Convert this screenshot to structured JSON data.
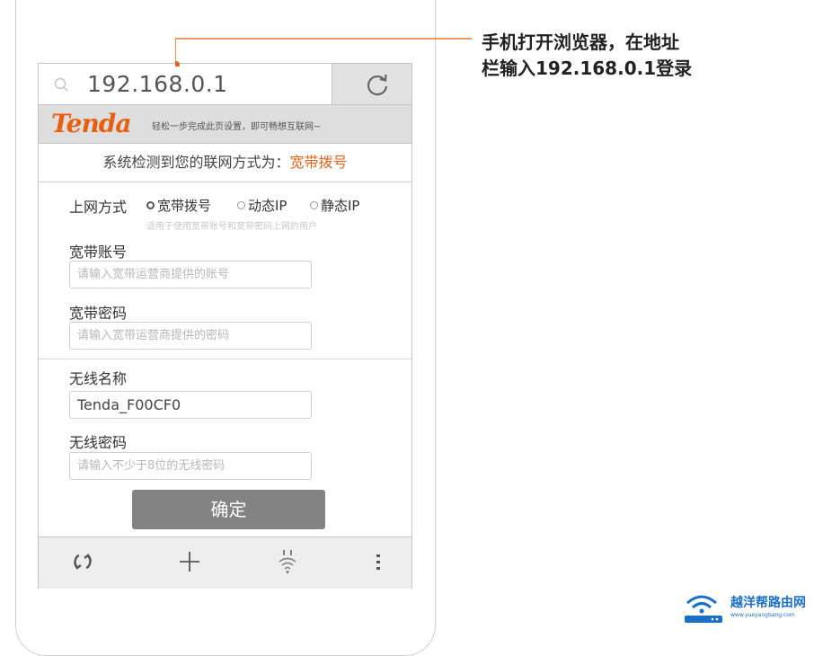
{
  "browser": {
    "url": "192.168.0.1"
  },
  "brand": {
    "logo": "Tenda",
    "slogan": "轻松一步完成此页设置，即可畅想互联网~"
  },
  "detect": {
    "prefix": "系统检测到您的联网方式为：",
    "mode": "宽带拨号"
  },
  "form": {
    "conn_label": "上网方式",
    "conn_options": [
      "宽带拨号",
      "动态IP",
      "静态IP"
    ],
    "conn_selected": "宽带拨号",
    "conn_hint": "适用于使用宽带账号和宽带密码上网的用户",
    "account_label": "宽带账号",
    "account_placeholder": "请输入宽带运营商提供的账号",
    "password_label": "宽带密码",
    "password_placeholder": "请输入宽带运营商提供的密码",
    "ssid_label": "无线名称",
    "ssid_value": "Tenda_F00CF0",
    "wifi_pwd_label": "无线密码",
    "wifi_pwd_placeholder": "请输入不少于8位的无线密码",
    "submit_label": "确定"
  },
  "callout": {
    "line1": "手机打开浏览器，在地址",
    "line2": "栏输入192.168.0.1登录"
  },
  "watermark": {
    "title": "越洋帮路由网",
    "subtitle": "www.yueyangbang.com"
  },
  "colors": {
    "accent": "#e8631a",
    "logo": "#e85f10",
    "button": "#838383",
    "watermark": "#1a70c8"
  }
}
